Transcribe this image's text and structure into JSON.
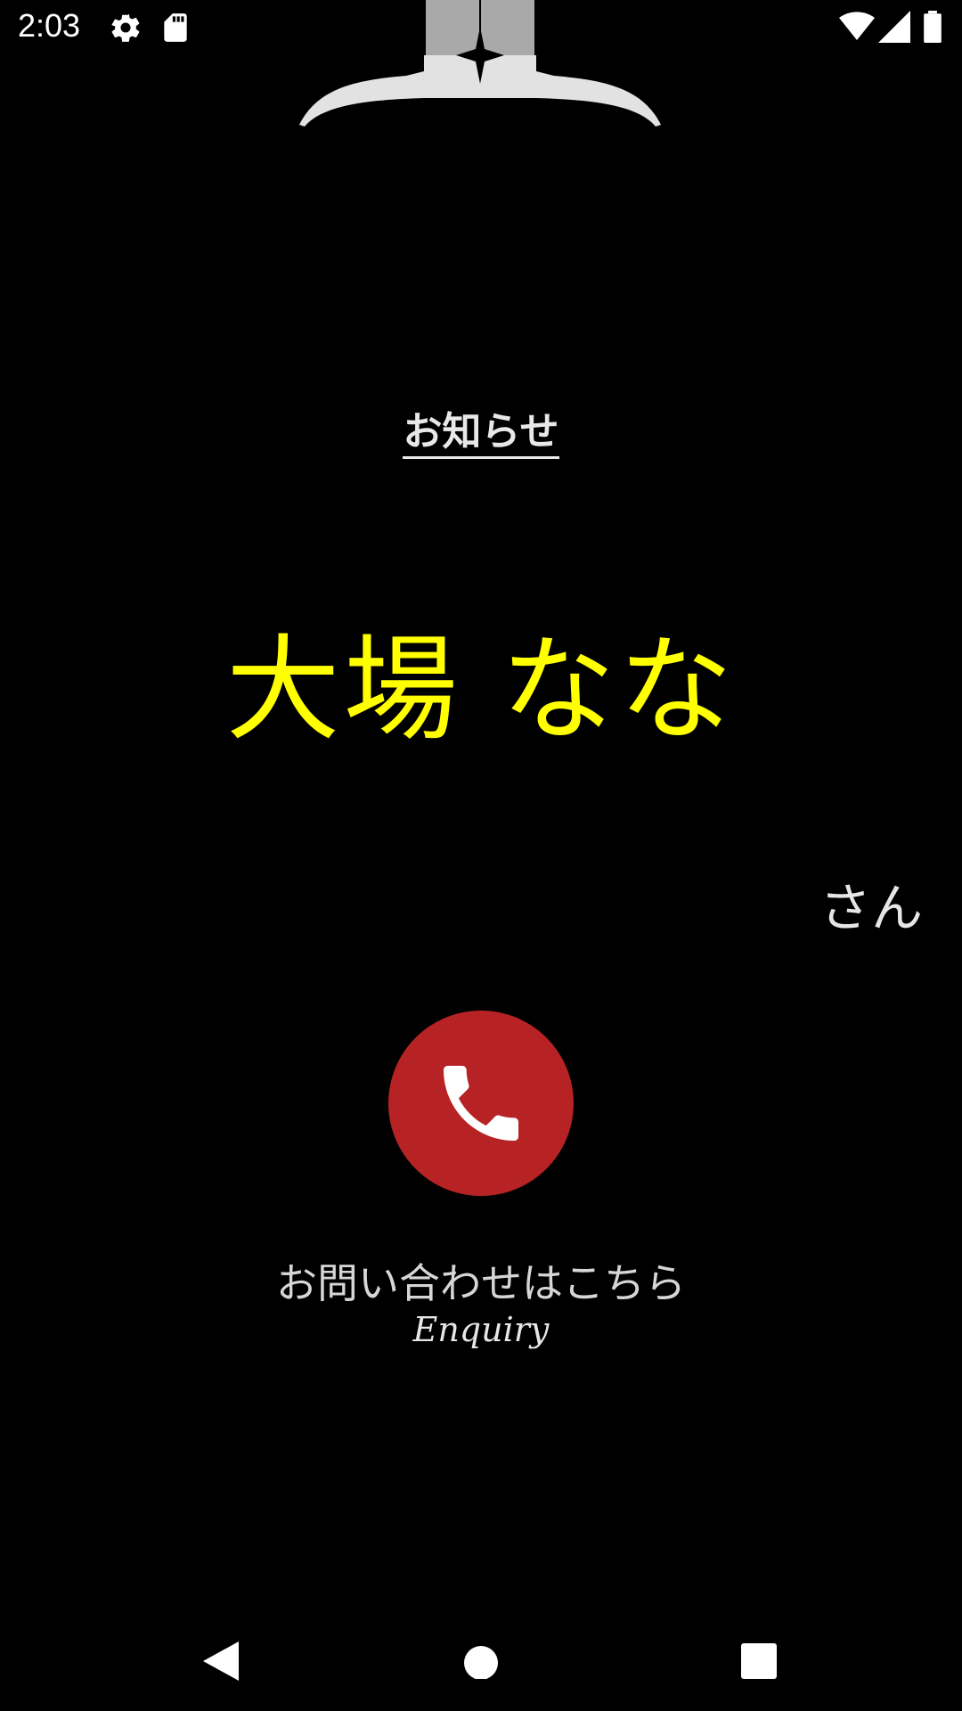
{
  "status_bar": {
    "time": "2:03",
    "icons": [
      "settings-icon",
      "sd-card-icon",
      "wifi-icon",
      "signal-icon",
      "battery-icon"
    ]
  },
  "header": {
    "logo": "shop-logo"
  },
  "notice": {
    "label": "お知らせ"
  },
  "user": {
    "name": "大場 なな",
    "honorific": "さん"
  },
  "enquiry": {
    "call_icon": "phone-icon",
    "label_jp": "お問い合わせはこちら",
    "label_en": "Enquiry"
  },
  "nav_bar": {
    "buttons": [
      "back-icon",
      "home-icon",
      "recents-icon"
    ]
  },
  "colors": {
    "background": "#000000",
    "name": "#ffff00",
    "call_button": "#b72324"
  }
}
